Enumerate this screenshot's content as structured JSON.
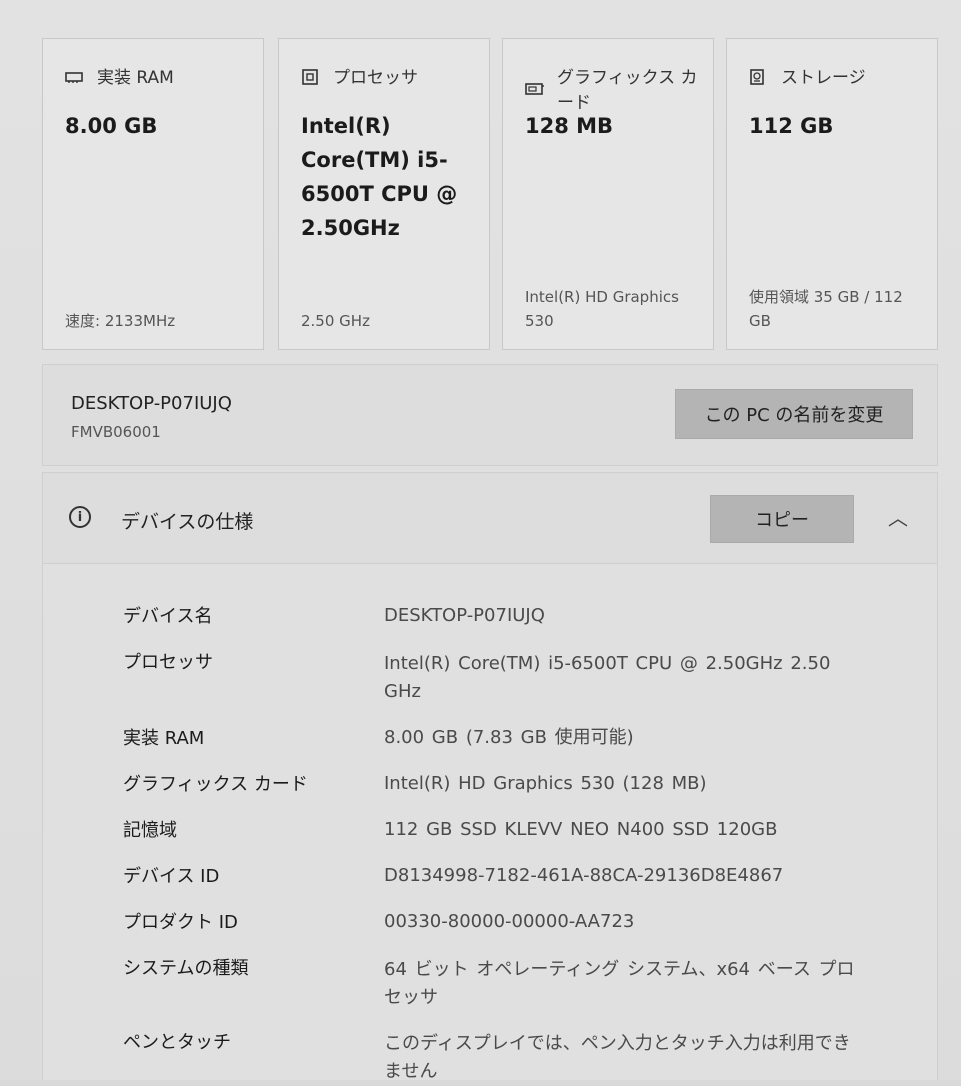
{
  "cards": [
    {
      "title": "実装 RAM",
      "icon": "ram-icon",
      "value": "8.00 GB",
      "footer": "速度: 2133MHz"
    },
    {
      "title": "プロセッサ",
      "icon": "processor-icon",
      "value": "Intel(R) Core(TM) i5-6500T CPU @ 2.50GHz",
      "footer": "2.50 GHz"
    },
    {
      "title": "グラフィックス カード",
      "icon": "graphics-card-icon",
      "value": "128 MB",
      "footer": "Intel(R) HD Graphics 530"
    },
    {
      "title": "ストレージ",
      "icon": "storage-icon",
      "value": "112 GB",
      "footer": "使用領域 35 GB / 112 GB"
    }
  ],
  "device": {
    "name": "DESKTOP-P07IUJQ",
    "model": "FMVB06001",
    "rename_label": "この PC の名前を変更"
  },
  "spec": {
    "title": "デバイスの仕様",
    "copy_label": "コピー",
    "collapse_glyph": "︿",
    "rows": [
      {
        "label": "デバイス名",
        "value": "DESKTOP-P07IUJQ"
      },
      {
        "label": "プロセッサ",
        "value": "Intel(R)  Core(TM)  i5-6500T  CPU  @  2.50GHz   2.50 GHz"
      },
      {
        "label": "実装 RAM",
        "value": "8.00 GB (7.83 GB 使用可能)"
      },
      {
        "label": "グラフィックス カード",
        "value": "Intel(R) HD Graphics 530 (128 MB)"
      },
      {
        "label": "記憶域",
        "value": "112 GB SSD KLEVV NEO N400 SSD 120GB"
      },
      {
        "label": "デバイス ID",
        "value": "D8134998-7182-461A-88CA-29136D8E4867"
      },
      {
        "label": "プロダクト ID",
        "value": "00330-80000-00000-AA723"
      },
      {
        "label": "システムの種類",
        "value": "64 ビット オペレーティング システム、x64 ベース プロセッサ"
      },
      {
        "label": "ペンとタッチ",
        "value": "このディスプレイでは、ペン入力とタッチ入力は利用できません"
      }
    ]
  }
}
